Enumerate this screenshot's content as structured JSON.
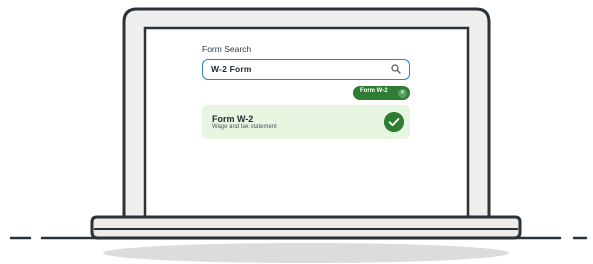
{
  "form_search": {
    "title": "Form Search",
    "query": "W-2 Form",
    "search_icon": "search-icon",
    "filter_chip": {
      "label": "Form W-2",
      "remove_icon": "close-icon"
    },
    "result": {
      "name": "Form W-2",
      "description": "Wage and tax statement",
      "status_icon": "check-circle-icon"
    }
  },
  "colors": {
    "accent_blue": "#2f7fd1",
    "success_green": "#2e7d32",
    "result_bg": "#e7f5e1",
    "outline": "#2b3238"
  }
}
